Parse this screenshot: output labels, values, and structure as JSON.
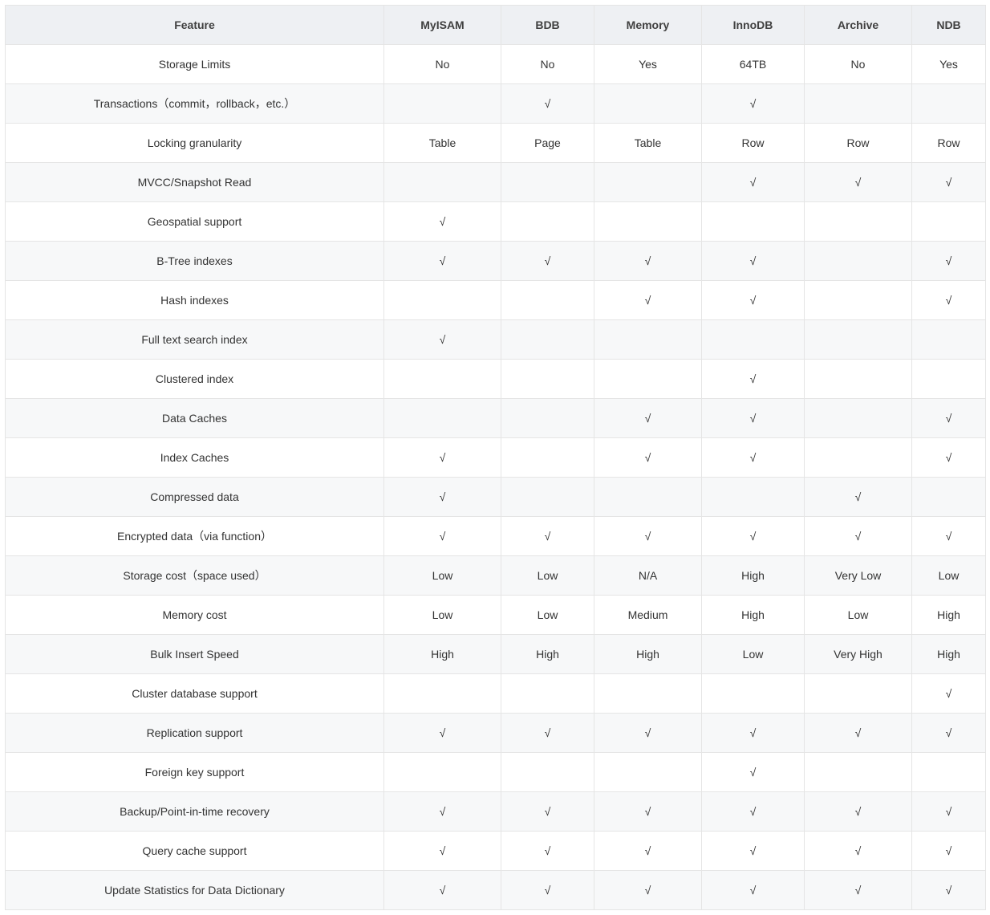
{
  "table": {
    "headers": [
      "Feature",
      "MyISAM",
      "BDB",
      "Memory",
      "InnoDB",
      "Archive",
      "NDB"
    ],
    "rows": [
      {
        "feature": "Storage Limits",
        "cells": [
          "No",
          "No",
          "Yes",
          "64TB",
          "No",
          "Yes"
        ]
      },
      {
        "feature": "Transactions（commit，rollback，etc.）",
        "cells": [
          "",
          "√",
          "",
          "√",
          "",
          ""
        ]
      },
      {
        "feature": "Locking granularity",
        "cells": [
          "Table",
          "Page",
          "Table",
          "Row",
          "Row",
          "Row"
        ]
      },
      {
        "feature": "MVCC/Snapshot Read",
        "cells": [
          "",
          "",
          "",
          "√",
          "√",
          "√"
        ]
      },
      {
        "feature": "Geospatial support",
        "cells": [
          "√",
          "",
          "",
          "",
          "",
          ""
        ]
      },
      {
        "feature": "B-Tree indexes",
        "cells": [
          "√",
          "√",
          "√",
          "√",
          "",
          "√"
        ]
      },
      {
        "feature": "Hash indexes",
        "cells": [
          "",
          "",
          "√",
          "√",
          "",
          "√"
        ]
      },
      {
        "feature": "Full text search index",
        "cells": [
          "√",
          "",
          "",
          "",
          "",
          ""
        ]
      },
      {
        "feature": "Clustered index",
        "cells": [
          "",
          "",
          "",
          "√",
          "",
          ""
        ]
      },
      {
        "feature": "Data Caches",
        "cells": [
          "",
          "",
          "√",
          "√",
          "",
          "√"
        ]
      },
      {
        "feature": "Index Caches",
        "cells": [
          "√",
          "",
          "√",
          "√",
          "",
          "√"
        ]
      },
      {
        "feature": "Compressed data",
        "cells": [
          "√",
          "",
          "",
          "",
          "√",
          ""
        ]
      },
      {
        "feature": "Encrypted data（via function）",
        "cells": [
          "√",
          "√",
          "√",
          "√",
          "√",
          "√"
        ]
      },
      {
        "feature": "Storage cost（space used）",
        "cells": [
          "Low",
          "Low",
          "N/A",
          "High",
          "Very Low",
          "Low"
        ]
      },
      {
        "feature": "Memory cost",
        "cells": [
          "Low",
          "Low",
          "Medium",
          "High",
          "Low",
          "High"
        ]
      },
      {
        "feature": "Bulk Insert Speed",
        "cells": [
          "High",
          "High",
          "High",
          "Low",
          "Very High",
          "High"
        ]
      },
      {
        "feature": "Cluster database support",
        "cells": [
          "",
          "",
          "",
          "",
          "",
          "√"
        ]
      },
      {
        "feature": "Replication support",
        "cells": [
          "√",
          "√",
          "√",
          "√",
          "√",
          "√"
        ]
      },
      {
        "feature": "Foreign key support",
        "cells": [
          "",
          "",
          "",
          "√",
          "",
          ""
        ]
      },
      {
        "feature": "Backup/Point-in-time recovery",
        "cells": [
          "√",
          "√",
          "√",
          "√",
          "√",
          "√"
        ]
      },
      {
        "feature": "Query cache support",
        "cells": [
          "√",
          "√",
          "√",
          "√",
          "√",
          "√"
        ]
      },
      {
        "feature": "Update Statistics for Data Dictionary",
        "cells": [
          "√",
          "√",
          "√",
          "√",
          "√",
          "√"
        ]
      }
    ]
  }
}
